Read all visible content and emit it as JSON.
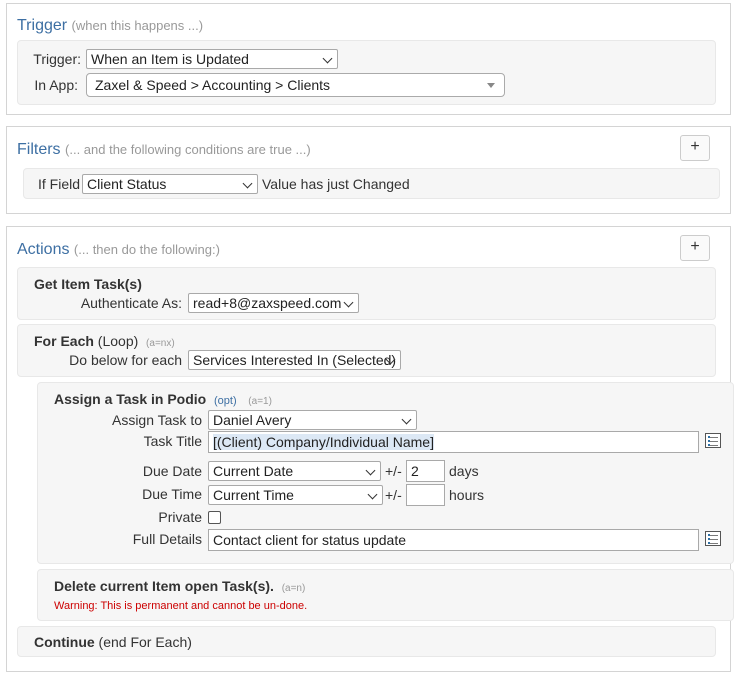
{
  "trigger": {
    "title": "Trigger",
    "hint": "(when this happens ...)",
    "trigger_label": "Trigger:",
    "trigger_value": "When an Item is Updated",
    "app_label": "In App:",
    "app_value": "Zaxel & Speed > Accounting > Clients"
  },
  "filters": {
    "title": "Filters",
    "hint": "(... and the following conditions are true ...)",
    "add_label": "+",
    "if_field_label": "If Field",
    "field_value": "Client Status",
    "condition_text": "Value has just Changed"
  },
  "actions": {
    "title": "Actions",
    "hint": "(... then do the following:)",
    "add_label": "+",
    "get_item_task": {
      "title": "Get Item Task(s)",
      "auth_label": "Authenticate As:",
      "auth_value": "read+8@zaxspeed.com"
    },
    "for_each": {
      "title": "For Each",
      "loop": "(Loop)",
      "note": "(a=nx)",
      "do_below_label": "Do below for each",
      "do_below_value": "Services Interested In (Selected)"
    },
    "assign_task": {
      "title": "Assign a Task in Podio",
      "opt": "(opt)",
      "note": "(a=1)",
      "assign_label": "Assign Task to",
      "assign_value": "Daniel Avery",
      "title_label": "Task Title",
      "title_value": "[(Client) Company/Individual Name]",
      "due_date_label": "Due Date",
      "due_date_value": "Current Date",
      "pm1": "+/-",
      "days_value": "2",
      "days_label": "days",
      "due_time_label": "Due Time",
      "due_time_value": "Current Time",
      "pm2": "+/-",
      "hours_value": "",
      "hours_label": "hours",
      "private_label": "Private",
      "details_label": "Full Details",
      "details_value": "Contact client for status update"
    },
    "delete_task": {
      "title": "Delete current Item open Task(s).",
      "note": "(a=n)",
      "warning": "Warning: This is permanent and cannot be un-done."
    },
    "continue": {
      "title": "Continue",
      "sub": "(end For Each)"
    }
  }
}
